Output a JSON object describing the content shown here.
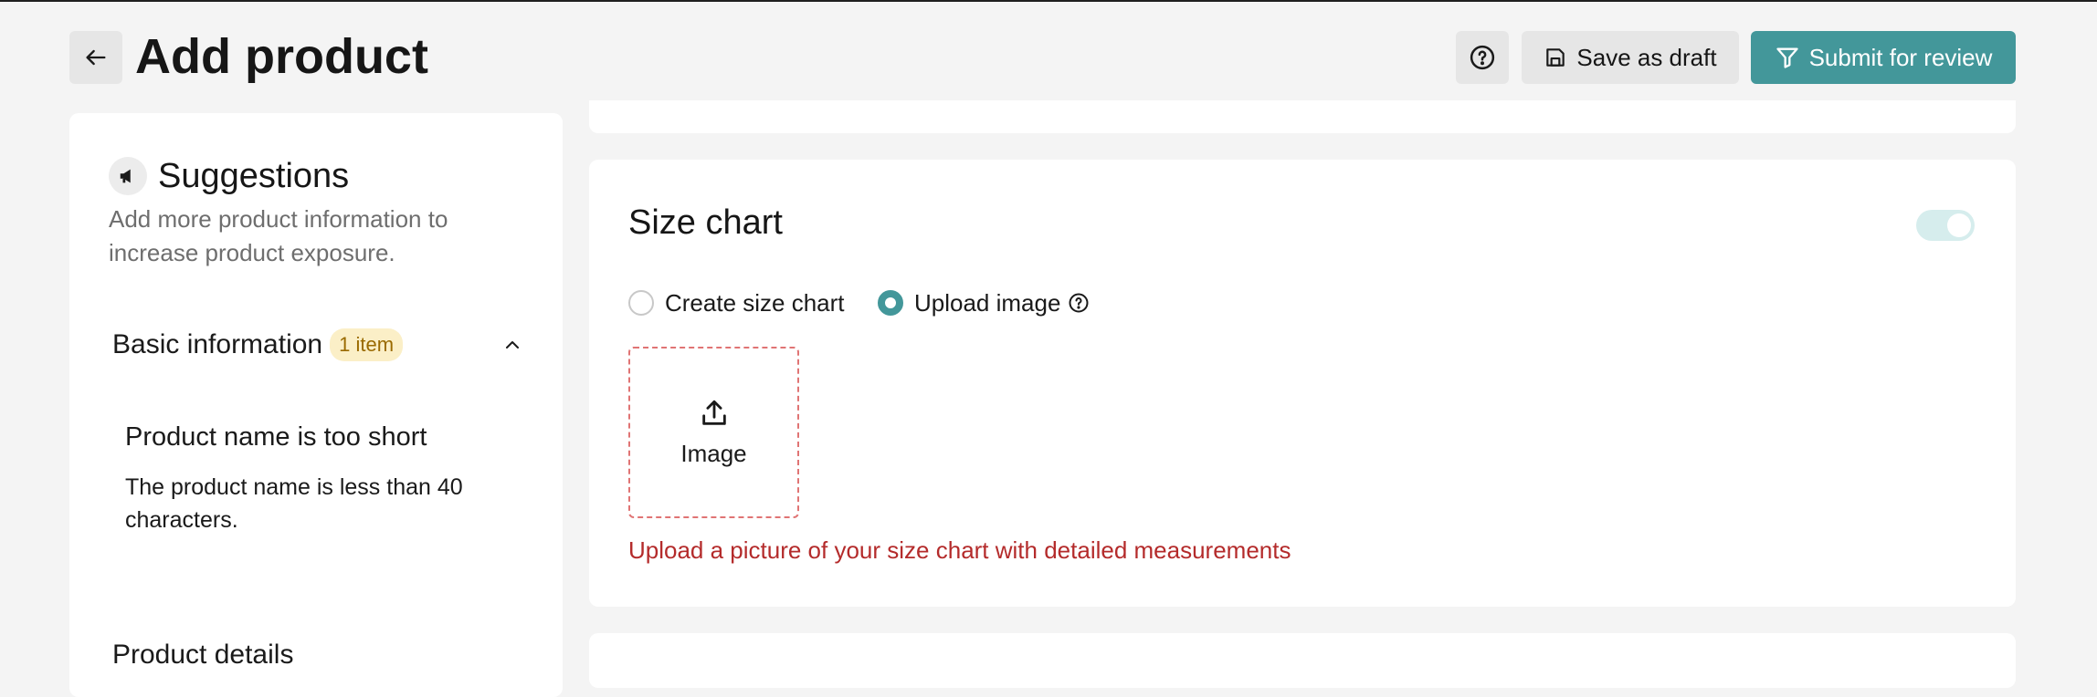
{
  "header": {
    "title": "Add product",
    "save_draft_label": "Save as draft",
    "submit_label": "Submit for review"
  },
  "suggestions": {
    "title": "Suggestions",
    "subtitle": "Add more product information to increase product exposure.",
    "sections": [
      {
        "label": "Basic information",
        "badge": "1 item",
        "expanded": true,
        "issues": [
          {
            "title": "Product name is too short",
            "description": "The product name is less than 40 characters."
          }
        ]
      },
      {
        "label": "Product details"
      }
    ]
  },
  "size_chart": {
    "title": "Size chart",
    "enabled": true,
    "options": [
      {
        "label": "Create size chart",
        "selected": false
      },
      {
        "label": "Upload image",
        "selected": true
      }
    ],
    "upload_label": "Image",
    "error": "Upload a picture of your size chart with detailed measurements"
  },
  "colors": {
    "accent": "#43979a",
    "error": "#b42b2b",
    "badge_bg": "#fbefc7",
    "badge_text": "#9a6a00"
  }
}
